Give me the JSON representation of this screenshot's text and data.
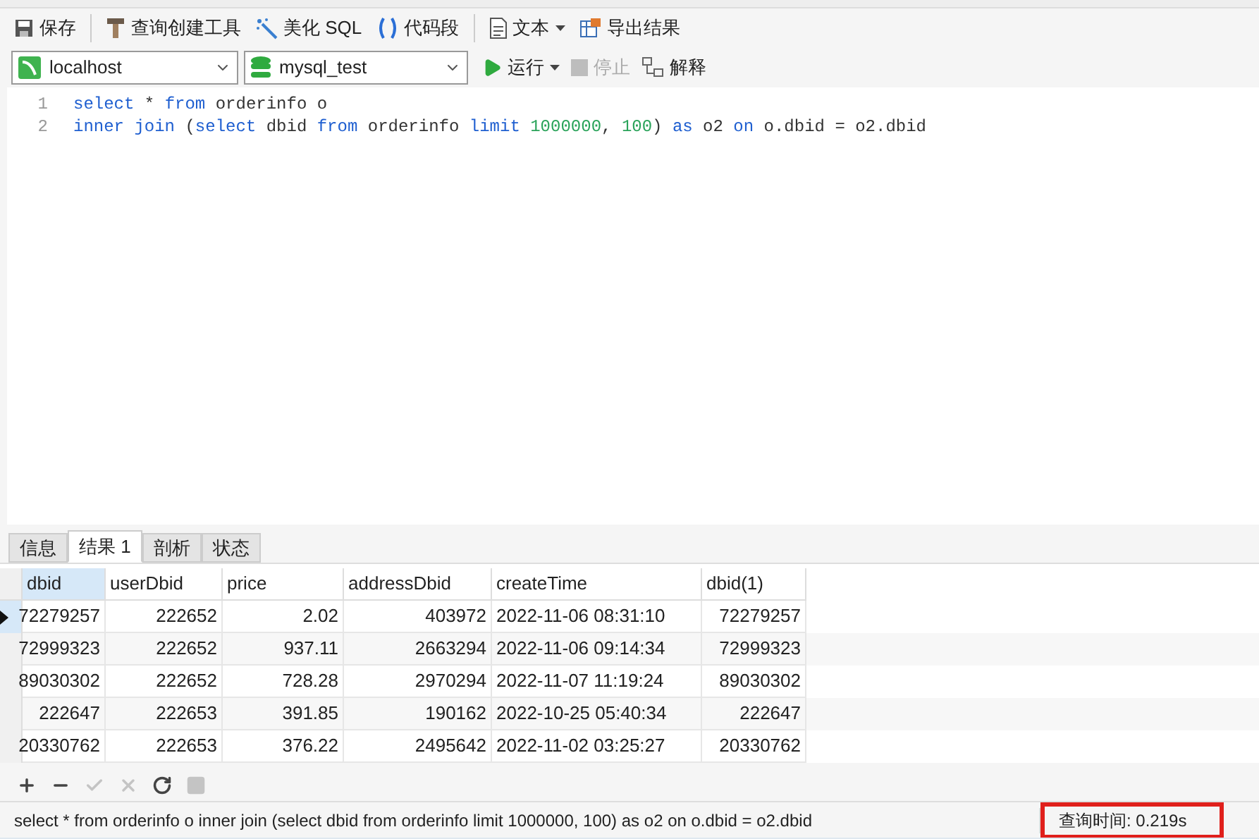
{
  "toolbar": [
    {
      "kind": "save",
      "label": "保存"
    },
    {
      "kind": "builder",
      "label": "查询创建工具"
    },
    {
      "kind": "beautify",
      "label": "美化 SQL"
    },
    {
      "kind": "snippet",
      "label": "代码段"
    },
    {
      "kind": "text",
      "label": "文本",
      "dropdown": true
    },
    {
      "kind": "export",
      "label": "导出结果"
    }
  ],
  "connection": {
    "value": "localhost"
  },
  "database": {
    "value": "mysql_test"
  },
  "actions": [
    {
      "kind": "run",
      "label": "运行",
      "disabled": false,
      "dropdown": true
    },
    {
      "kind": "stop",
      "label": "停止",
      "disabled": true
    },
    {
      "kind": "explain",
      "label": "解释",
      "disabled": false
    }
  ],
  "editor": {
    "lines": [
      {
        "number": "1",
        "tokens": [
          {
            "kind": "keyword",
            "text": "select"
          },
          {
            "kind": "plain",
            "text": " * "
          },
          {
            "kind": "keyword",
            "text": "from"
          },
          {
            "kind": "plain",
            "text": " orderinfo o"
          }
        ]
      },
      {
        "number": "2",
        "tokens": [
          {
            "kind": "keyword",
            "text": "inner join"
          },
          {
            "kind": "plain",
            "text": " ("
          },
          {
            "kind": "keyword",
            "text": "select"
          },
          {
            "kind": "plain",
            "text": " dbid "
          },
          {
            "kind": "keyword",
            "text": "from"
          },
          {
            "kind": "plain",
            "text": " orderinfo "
          },
          {
            "kind": "keyword",
            "text": "limit "
          },
          {
            "kind": "number",
            "text": "1000000"
          },
          {
            "kind": "plain",
            "text": ", "
          },
          {
            "kind": "number",
            "text": "100"
          },
          {
            "kind": "plain",
            "text": ") "
          },
          {
            "kind": "keyword",
            "text": "as"
          },
          {
            "kind": "plain",
            "text": " o2 "
          },
          {
            "kind": "keyword",
            "text": "on"
          },
          {
            "kind": "plain",
            "text": " o.dbid = o2.dbid"
          }
        ]
      }
    ]
  },
  "result_tabs": [
    {
      "label": "信息",
      "selected": false
    },
    {
      "label": "结果 1",
      "selected": true
    },
    {
      "label": "剖析",
      "selected": false
    },
    {
      "label": "状态",
      "selected": false
    }
  ],
  "table": {
    "columns": [
      {
        "label": "dbid",
        "selected": true
      },
      {
        "label": "userDbid",
        "selected": false
      },
      {
        "label": "price",
        "selected": false
      },
      {
        "label": "addressDbid",
        "selected": false
      },
      {
        "label": "createTime",
        "selected": false
      },
      {
        "label": "dbid(1)",
        "selected": false
      }
    ],
    "rows": [
      {
        "selected": true,
        "cells": [
          "72279257",
          "222652",
          "2.02",
          "403972",
          "2022-11-06 08:31:10",
          "72279257"
        ]
      },
      {
        "selected": false,
        "cells": [
          "72999323",
          "222652",
          "937.11",
          "2663294",
          "2022-11-06 09:14:34",
          "72999323"
        ]
      },
      {
        "selected": false,
        "cells": [
          "89030302",
          "222652",
          "728.28",
          "2970294",
          "2022-11-07 11:19:24",
          "89030302"
        ]
      },
      {
        "selected": false,
        "cells": [
          "222647",
          "222653",
          "391.85",
          "190162",
          "2022-10-25 05:40:34",
          "222647"
        ]
      },
      {
        "selected": false,
        "cells": [
          "20330762",
          "222653",
          "376.22",
          "2495642",
          "2022-11-02 03:25:27",
          "20330762"
        ]
      }
    ]
  },
  "grid_tools": [
    {
      "kind": "add",
      "disabled": false
    },
    {
      "kind": "remove",
      "disabled": false
    },
    {
      "kind": "apply",
      "disabled": true
    },
    {
      "kind": "discard",
      "disabled": true
    },
    {
      "kind": "refresh",
      "disabled": false
    },
    {
      "kind": "stop",
      "disabled": true
    }
  ],
  "status_bar": {
    "sql": "select * from orderinfo o  inner join (select dbid from orderinfo limit 1000000, 100) as o2 on o.dbid = o2.dbid",
    "query_time": "查询时间: 0.219s",
    "highlighted": true
  }
}
